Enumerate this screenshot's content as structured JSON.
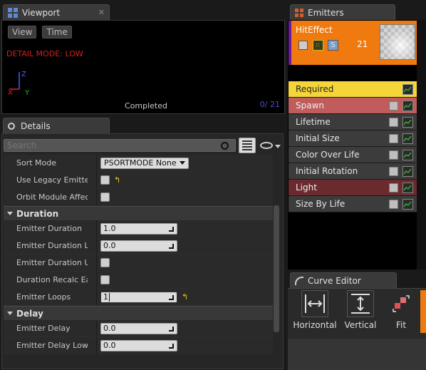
{
  "viewport": {
    "tab_title": "Viewport",
    "close_glyph": "✕",
    "view_btn": "View",
    "time_btn": "Time",
    "detail_mode": "DETAIL MODE: LOW",
    "status": "Completed",
    "counter": "0/ 21"
  },
  "details": {
    "tab_title": "Details",
    "search_placeholder": "Search",
    "rows_top": [
      {
        "label": "Sort Mode",
        "value": "PSORTMODE None"
      },
      {
        "label": "Use Legacy Emitter Ti"
      },
      {
        "label": "Orbit Module Affects V"
      }
    ],
    "duration": {
      "header": "Duration",
      "emitter_duration": {
        "label": "Emitter Duration",
        "value": "1.0"
      },
      "emitter_duration_low": {
        "label": "Emitter Duration Low",
        "value": "0.0"
      },
      "duration_use_r": {
        "label": "Emitter Duration Use R"
      },
      "duration_recalc": {
        "label": "Duration Recalc Each L"
      },
      "emitter_loops": {
        "label": "Emitter Loops",
        "value": "1"
      }
    },
    "delay": {
      "header": "Delay",
      "emitter_delay": {
        "label": "Emitter Delay",
        "value": "0.0"
      },
      "emitter_delay_low": {
        "label": "Emitter Delay Low",
        "value": "0.0"
      }
    }
  },
  "emitters": {
    "tab_title": "Emitters",
    "emitter_name": "HitEffect",
    "emitter_count": "21",
    "s_badge": "S",
    "header_color": "#f07a10",
    "modules": [
      {
        "label": "Required",
        "bg": "#f5d63a",
        "fg": "#222222"
      },
      {
        "label": "Spawn",
        "bg": "#c05c5c",
        "fg": "#f0f0f0"
      },
      {
        "label": "Lifetime",
        "bg": "#3c3c3c",
        "fg": "#e6e6e6"
      },
      {
        "label": "Initial Size",
        "bg": "#3c3c3c",
        "fg": "#e6e6e6"
      },
      {
        "label": "Color Over Life",
        "bg": "#3c3c3c",
        "fg": "#e6e6e6"
      },
      {
        "label": "Initial Rotation",
        "bg": "#3c3c3c",
        "fg": "#e6e6e6"
      },
      {
        "label": "Light",
        "bg": "#6a2a2e",
        "fg": "#f0f0f0"
      },
      {
        "label": "Size By Life",
        "bg": "#3c3c3c",
        "fg": "#e6e6e6"
      }
    ]
  },
  "curve_editor": {
    "tab_title": "Curve Editor",
    "buttons": [
      {
        "label": "Horizontal"
      },
      {
        "label": "Vertical"
      },
      {
        "label": "Fit"
      }
    ]
  }
}
